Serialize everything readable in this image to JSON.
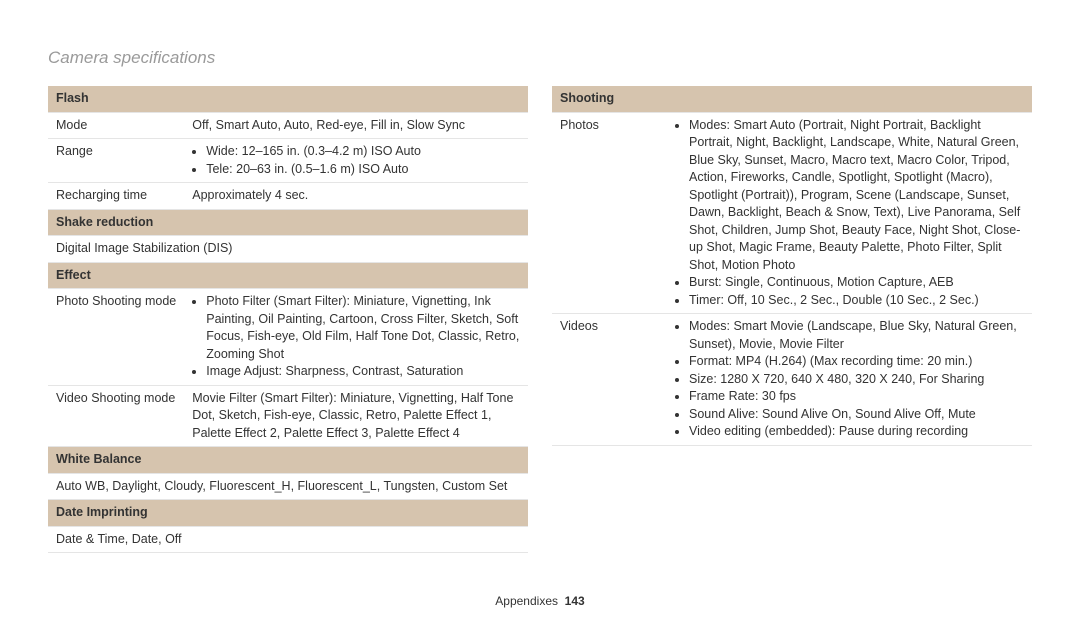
{
  "page": {
    "title": "Camera specifications",
    "footer_label": "Appendixes",
    "footer_page": "143"
  },
  "left": {
    "sections": [
      {
        "header": "Flash"
      },
      {
        "label": "Mode",
        "value": "Off, Smart Auto, Auto, Red-eye, Fill in, Slow Sync"
      },
      {
        "label": "Range",
        "list": [
          "Wide: 12–165 in. (0.3–4.2 m) ISO Auto",
          "Tele: 20–63 in. (0.5–1.6 m) ISO Auto"
        ]
      },
      {
        "label": "Recharging time",
        "value": "Approximately 4 sec."
      },
      {
        "header": "Shake reduction"
      },
      {
        "full": "Digital Image Stabilization (DIS)"
      },
      {
        "header": "Effect"
      },
      {
        "label": "Photo Shooting mode",
        "list": [
          "Photo Filter (Smart Filter): Miniature, Vignetting, Ink Painting, Oil Painting, Cartoon, Cross Filter, Sketch, Soft Focus, Fish-eye, Old Film, Half Tone Dot, Classic, Retro, Zooming Shot",
          "Image Adjust: Sharpness, Contrast, Saturation"
        ]
      },
      {
        "label": "Video Shooting mode",
        "value": "Movie Filter (Smart Filter): Miniature, Vignetting, Half Tone Dot, Sketch, Fish-eye, Classic, Retro, Palette Effect 1, Palette Effect 2, Palette Effect 3, Palette Effect 4"
      },
      {
        "header": "White Balance"
      },
      {
        "full": "Auto WB, Daylight, Cloudy, Fluorescent_H, Fluorescent_L, Tungsten, Custom Set"
      },
      {
        "header": "Date Imprinting"
      },
      {
        "full": "Date & Time, Date, Off"
      }
    ]
  },
  "right": {
    "sections": [
      {
        "header": "Shooting"
      },
      {
        "label": "Photos",
        "list": [
          "Modes: Smart Auto (Portrait, Night Portrait, Backlight Portrait, Night, Backlight, Landscape, White, Natural Green, Blue Sky, Sunset, Macro, Macro text, Macro Color, Tripod, Action, Fireworks, Candle, Spotlight, Spotlight (Macro), Spotlight (Portrait)), Program, Scene (Landscape, Sunset, Dawn, Backlight, Beach & Snow, Text), Live Panorama, Self Shot, Children, Jump Shot, Beauty Face, Night Shot, Close-up Shot, Magic Frame, Beauty Palette, Photo Filter, Split Shot, Motion Photo",
          "Burst: Single, Continuous, Motion Capture, AEB",
          "Timer: Off, 10 Sec., 2 Sec., Double (10 Sec., 2 Sec.)"
        ]
      },
      {
        "label": "Videos",
        "list": [
          "Modes: Smart Movie (Landscape, Blue Sky, Natural Green, Sunset), Movie, Movie Filter",
          "Format: MP4 (H.264) (Max recording time: 20 min.)",
          "Size: 1280 X 720, 640 X 480, 320 X 240, For Sharing",
          "Frame Rate: 30 fps",
          "Sound Alive: Sound Alive On, Sound Alive Off, Mute",
          "Video editing (embedded): Pause during recording"
        ]
      }
    ]
  }
}
